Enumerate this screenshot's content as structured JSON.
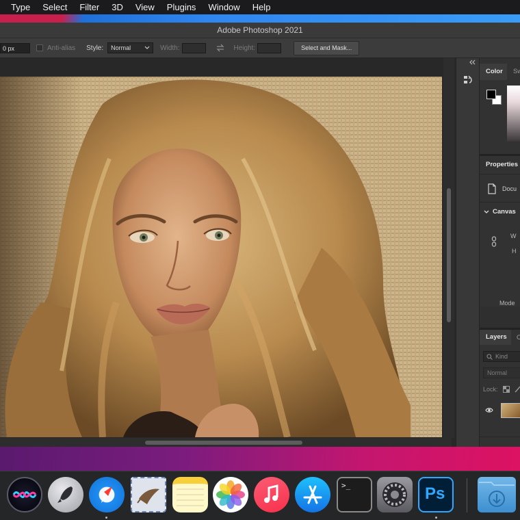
{
  "menubar": {
    "items": [
      "Type",
      "Select",
      "Filter",
      "3D",
      "View",
      "Plugins",
      "Window",
      "Help"
    ]
  },
  "window": {
    "title": "Adobe Photoshop 2021"
  },
  "options_bar": {
    "feather_value": "0 px",
    "anti_alias_label": "Anti-alias",
    "style_label": "Style:",
    "style_value": "Normal",
    "width_label": "Width:",
    "height_label": "Height:",
    "select_mask_label": "Select and Mask..."
  },
  "panels": {
    "color_tab": "Color",
    "swatches_tab": "Sw",
    "properties_tab": "Properties",
    "document_label": "Docu",
    "canvas_section": "Canvas",
    "w_label": "W",
    "h_label": "H",
    "mode_label": "Mode",
    "layers_tab": "Layers",
    "layers_tab2": "C",
    "kind_placeholder": "Kind",
    "blend_mode": "Normal",
    "lock_label": "Lock:"
  },
  "dock": {
    "apps": [
      "Siri",
      "Launchpad",
      "Safari",
      "Mail",
      "Notes",
      "Photos",
      "Music",
      "App Store",
      "Terminal",
      "System Preferences",
      "Photoshop",
      "Downloads"
    ],
    "ps_label": "Ps",
    "terminal_prompt": ">_"
  },
  "colors": {
    "menubar_bg": "#1b1b1d",
    "ps_panel_bg": "#323232",
    "ps_accent": "#31a8ff"
  }
}
